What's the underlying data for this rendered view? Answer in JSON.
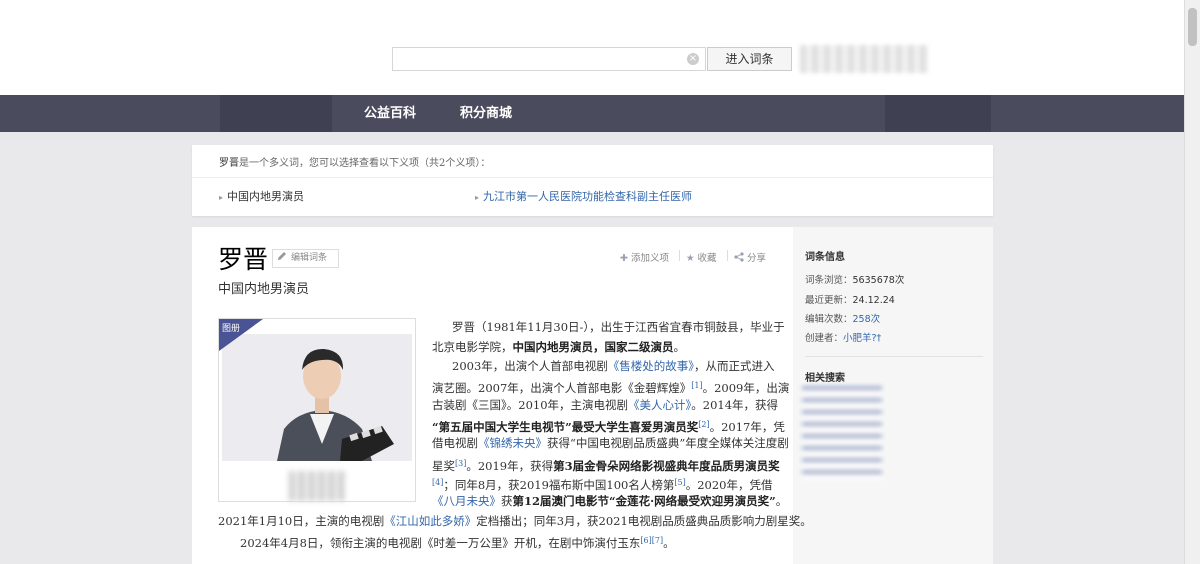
{
  "search": {
    "value": "",
    "clear_glyph": "×",
    "enter_label": "进入词条"
  },
  "nav": {
    "items": [
      "公益百科",
      "积分商城"
    ]
  },
  "polysemy": {
    "term": "罗晋",
    "notice": "是一个多义词，您可以选择查看以下义项（共2个义项）：",
    "options": [
      "中国内地男演员",
      "九江市第一人民医院功能检查科副主任医师"
    ]
  },
  "article": {
    "title": "罗晋",
    "edit_label": "编辑词条",
    "subtitle": "中国内地男演员",
    "actions": {
      "add": "添加义项",
      "collect": "收藏",
      "share": "分享"
    },
    "album_label": "图册",
    "paragraphs": {
      "p1_l1a": "罗晋（1981年11月30日-），出生于江西省宜春市铜鼓县，毕业于",
      "p1_l2a": "北京电影学院，",
      "p1_l2b": "中国内地男演员，国家二级演员",
      "p1_l2c": "。",
      "p2_l1a": "2003年，出演个人首部电视剧",
      "p2_l1b": "《售楼处的故事》",
      "p2_l1c": "，从而正式进入",
      "p2_l2a": "演艺圈。2007年，出演个人首部电影《金碧辉煌》",
      "p2_l2s": "[1]",
      "p2_l2b": "。2009年，出演",
      "p2_l3a": "古装剧《三国》。2010年，主演电视剧",
      "p2_l3b": "《美人心计》",
      "p2_l3c": "。2014年，获得",
      "p2_l4a": "“第五届中国大学生电视节”最受大学生喜爱男演员奖",
      "p2_l4s": "[2]",
      "p2_l4b": "。2017年，凭",
      "p2_l5a": "借电视剧",
      "p2_l5b": "《锦绣未央》",
      "p2_l5c": "获得“中国电视剧品质盛典”年度全媒体关注度剧",
      "p2_l6a": "星奖",
      "p2_l6s": "[3]",
      "p2_l6b": "。2019年，获得",
      "p2_l6c": "第3届金骨朵网络影视盛典年度品质男演员奖",
      "p2_l7s": "[4]",
      "p2_l7a": "；同年8月，获2019福布斯中国100名人榜第",
      "p2_l7b": "[5]",
      "p2_l7c": "。2020年，凭借",
      "p2_l8a": "《八月未央》",
      "p2_l8b": "获",
      "p2_l8c": "第12届澳门电影节“金莲花·网络最受欢迎男演员奖”",
      "p2_l8d": "。",
      "p2_l9a": "2021年1月10日，主演的电视剧",
      "p2_l9b": "《江山如此多娇》",
      "p2_l9c": "定档播出；同年3月，获2021电视剧品质盛典品质影响力剧星奖。",
      "p3_a": "2024年4月8日，领衔主演的电视剧《时差一万公里》开机，在剧中饰演付玉东",
      "p3_s": "[6][7]",
      "p3_b": "。"
    }
  },
  "sidebar": {
    "info_title": "词条信息",
    "views_label": "词条浏览：",
    "views_value": "5635678次",
    "updated_label": "最近更新：",
    "updated_value": "24.12.24",
    "edits_label": "编辑次数：",
    "edits_value": "258次",
    "creator_label": "创建者：",
    "creator_value": "小肥羊?†",
    "related_title": "相关搜索"
  },
  "colors": {
    "nav_bg": "#4a4b5c",
    "link": "#3366aa",
    "album_tag": "#4a5393"
  }
}
